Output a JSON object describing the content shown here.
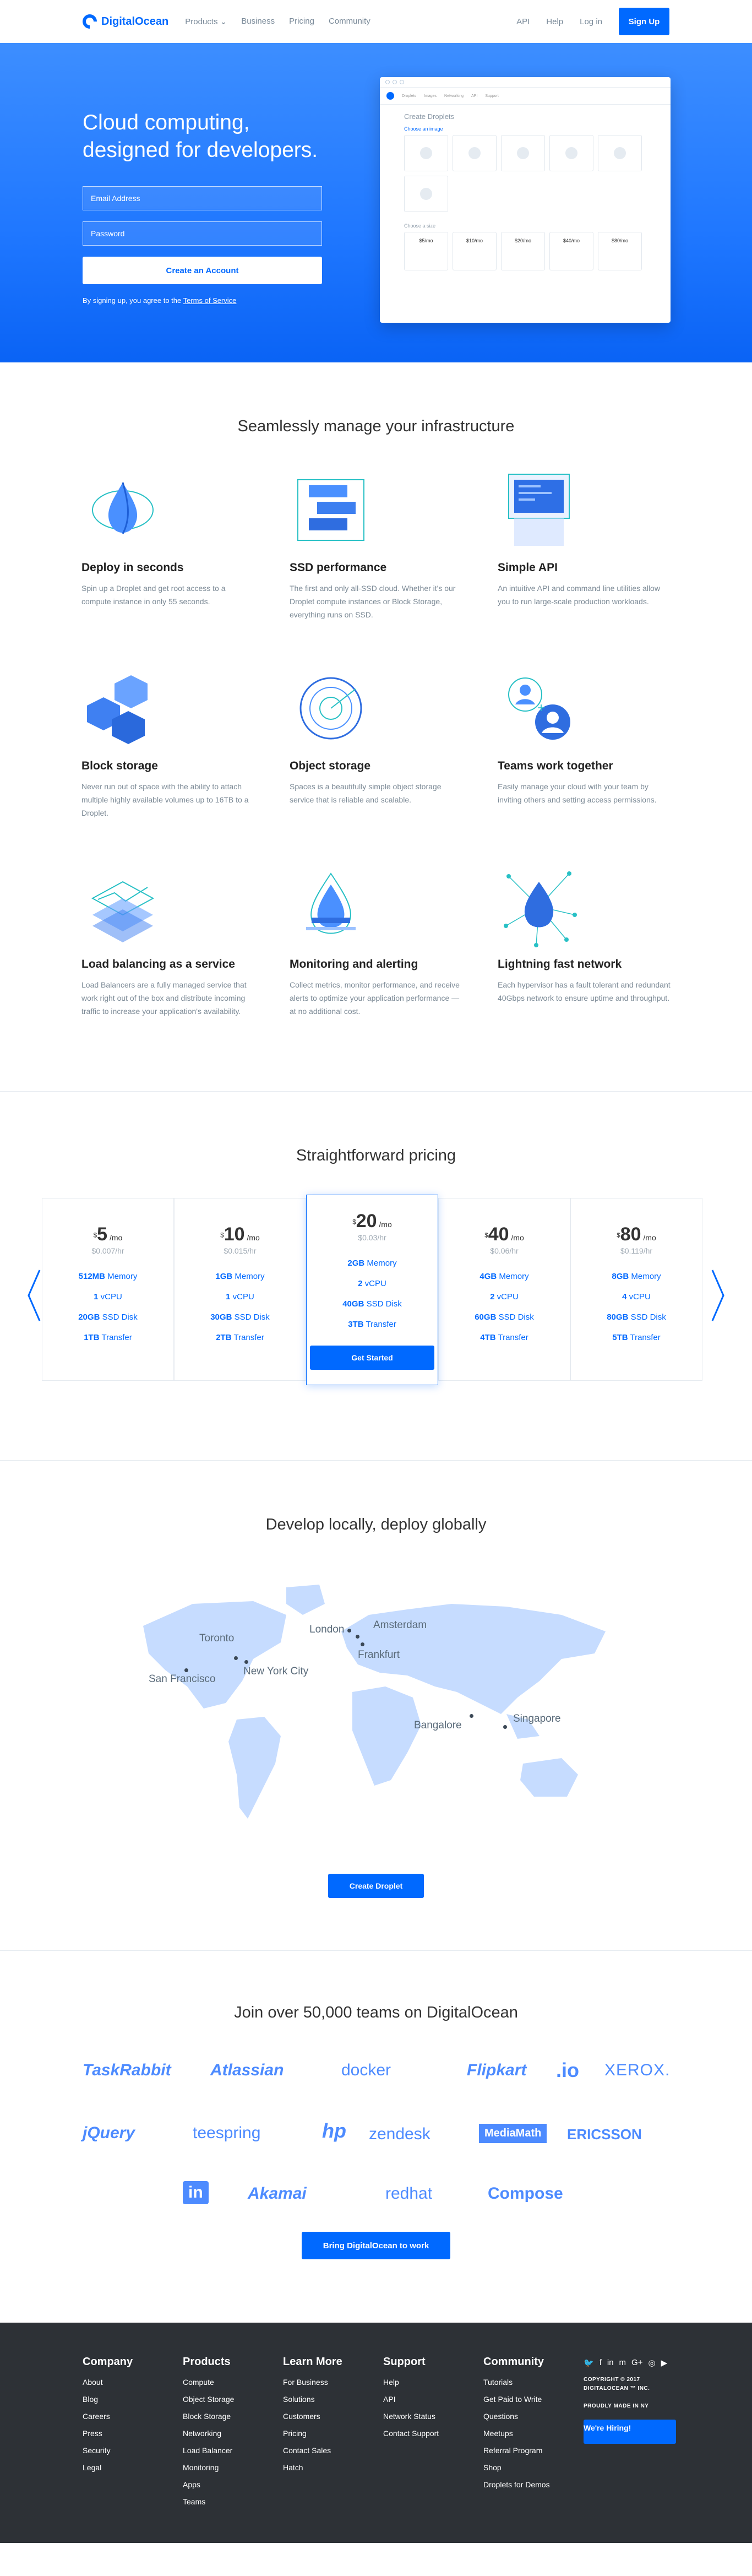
{
  "nav": {
    "brand": "DigitalOcean",
    "links": [
      "Products",
      "Business",
      "Pricing",
      "Community"
    ],
    "right": [
      "API",
      "Help",
      "Log in"
    ],
    "signup": "Sign Up"
  },
  "hero": {
    "title_line1": "Cloud computing,",
    "title_line2": "designed for developers.",
    "email_placeholder": "Email Address",
    "password_placeholder": "Password",
    "cta": "Create an Account",
    "terms_prefix": "By signing up, you agree to the ",
    "terms_link": "Terms of Service",
    "mock": {
      "nav": [
        "Droplets",
        "Images",
        "Networking",
        "API",
        "Support"
      ],
      "title": "Create Droplets",
      "choose_image": "Choose an image",
      "choose_size": "Choose a size",
      "size_prices": [
        "$5/mo",
        "$10/mo",
        "$20/mo",
        "$40/mo",
        "$80/mo"
      ]
    }
  },
  "features": {
    "title": "Seamlessly manage your infrastructure",
    "items": [
      {
        "title": "Deploy in seconds",
        "text": "Spin up a Droplet and get root access to a compute instance in only 55 seconds."
      },
      {
        "title": "SSD performance",
        "text": "The first and only all-SSD cloud. Whether it's our Droplet compute instances or Block Storage, everything runs on SSD."
      },
      {
        "title": "Simple API",
        "text": "An intuitive API and command line utilities allow you to run large-scale production workloads."
      },
      {
        "title": "Block storage",
        "text": "Never run out of space with the ability to attach multiple highly available volumes up to 16TB to a Droplet."
      },
      {
        "title": "Object storage",
        "text": "Spaces is a beautifully simple object storage service that is reliable and scalable."
      },
      {
        "title": "Teams work together",
        "text": "Easily manage your cloud with your team by inviting others and setting access permissions."
      },
      {
        "title": "Load balancing as a service",
        "text": "Load Balancers are a fully managed service that work right out of the box and distribute incoming traffic to increase your application's availability."
      },
      {
        "title": "Monitoring and alerting",
        "text": "Collect metrics, monitor performance, and receive alerts to optimize your application performance — at no additional cost."
      },
      {
        "title": "Lightning fast network",
        "text": "Each hypervisor has a fault tolerant and redundant 40Gbps network to ensure uptime and throughput."
      }
    ]
  },
  "pricing": {
    "title": "Straightforward pricing",
    "plans": [
      {
        "price": "5",
        "per": "/mo",
        "hourly": "$0.007/hr",
        "memory": "512MB",
        "cpu": "1",
        "disk": "20GB",
        "transfer": "1TB"
      },
      {
        "price": "10",
        "per": "/mo",
        "hourly": "$0.015/hr",
        "memory": "1GB",
        "cpu": "1",
        "disk": "30GB",
        "transfer": "2TB"
      },
      {
        "price": "20",
        "per": "/mo",
        "hourly": "$0.03/hr",
        "memory": "2GB",
        "cpu": "2",
        "disk": "40GB",
        "transfer": "3TB"
      },
      {
        "price": "40",
        "per": "/mo",
        "hourly": "$0.06/hr",
        "memory": "4GB",
        "cpu": "2",
        "disk": "60GB",
        "transfer": "4TB"
      },
      {
        "price": "80",
        "per": "/mo",
        "hourly": "$0.119/hr",
        "memory": "8GB",
        "cpu": "4",
        "disk": "80GB",
        "transfer": "5TB"
      }
    ],
    "labels": {
      "memory": "Memory",
      "cpu": "vCPU",
      "disk": "SSD Disk",
      "transfer": "Transfer",
      "currency": "$"
    },
    "cta": "Get Started"
  },
  "map": {
    "title": "Develop locally, deploy globally",
    "cities": [
      "Toronto",
      "San Francisco",
      "New York City",
      "London",
      "Amsterdam",
      "Frankfurt",
      "Bangalore",
      "Singapore"
    ],
    "cta": "Create Droplet"
  },
  "customers": {
    "title": "Join over 50,000 teams on DigitalOcean",
    "logos": [
      "TaskRabbit",
      "Atlassian",
      "docker",
      "Flipkart",
      ".io",
      "XEROX.",
      "jQuery",
      "teespring",
      "hp",
      "zendesk",
      "MediaMath",
      "ERICSSON",
      "in",
      "Akamai",
      "redhat",
      "Compose"
    ],
    "cta": "Bring DigitalOcean to work"
  },
  "footer": {
    "columns": [
      {
        "title": "Company",
        "links": [
          "About",
          "Blog",
          "Careers",
          "Press",
          "Security",
          "Legal"
        ]
      },
      {
        "title": "Products",
        "links": [
          "Compute",
          "Object Storage",
          "Block Storage",
          "Networking",
          "Load Balancer",
          "Monitoring",
          "Apps",
          "Teams"
        ]
      },
      {
        "title": "Learn More",
        "links": [
          "For Business",
          "Solutions",
          "Customers",
          "Pricing",
          "Contact Sales",
          "Hatch"
        ]
      },
      {
        "title": "Support",
        "links": [
          "Help",
          "API",
          "Network Status",
          "Contact Support"
        ]
      },
      {
        "title": "Community",
        "links": [
          "Tutorials",
          "Get Paid to Write",
          "Questions",
          "Meetups",
          "Referral Program",
          "Shop",
          "Droplets for Demos"
        ]
      }
    ],
    "copyright": "COPYRIGHT © 2017",
    "company": "DIGITALOCEAN ™ INC.",
    "made_in": "PROUDLY MADE IN NY",
    "hiring": "We're Hiring!"
  },
  "colors": {
    "brand": "#0069ff",
    "footer_bg": "#2d3136",
    "muted": "#7c8a96"
  }
}
